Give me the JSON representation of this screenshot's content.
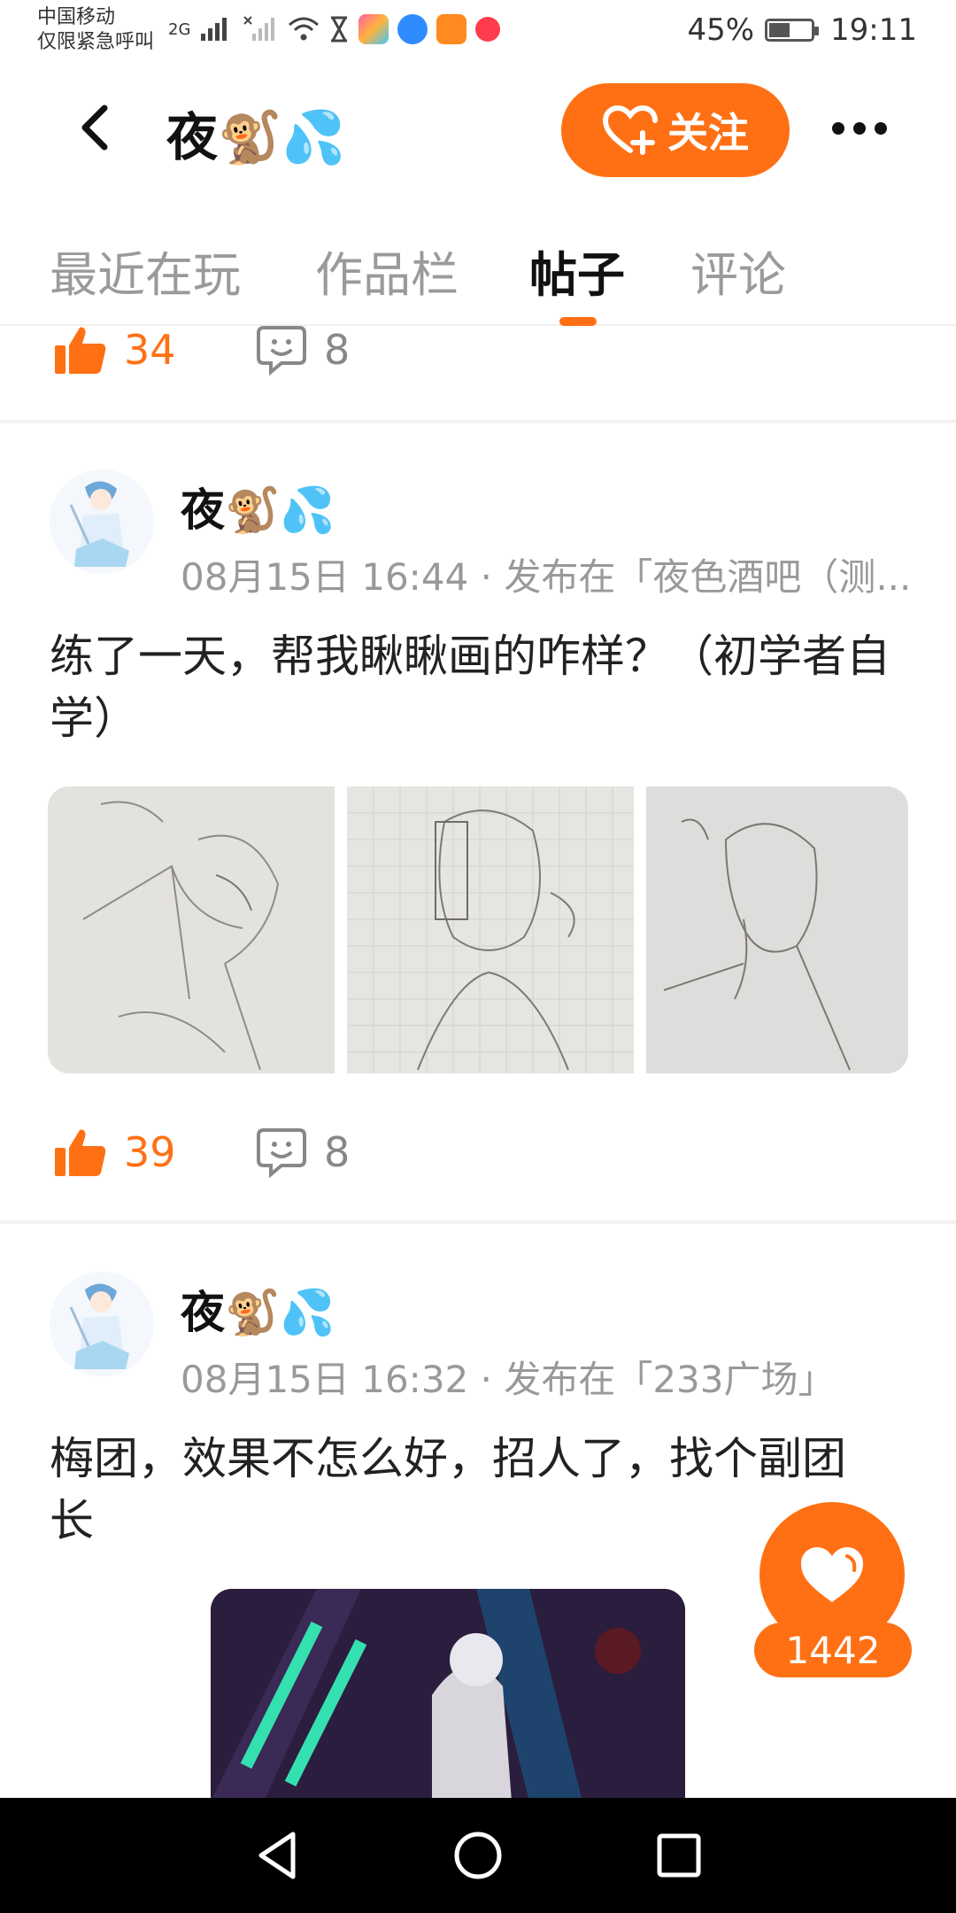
{
  "status_bar": {
    "carrier_line1": "中国移动",
    "carrier_line2": "仅限紧急呼叫",
    "network": "2G",
    "battery": "45%",
    "time": "19:11"
  },
  "header": {
    "title": "夜🐒💦",
    "follow_label": "关注"
  },
  "tabs": [
    {
      "label": "最近在玩"
    },
    {
      "label": "作品栏"
    },
    {
      "label": "帖子"
    },
    {
      "label": "评论"
    }
  ],
  "top_stats": {
    "likes": "34",
    "comments": "8"
  },
  "posts": [
    {
      "author": "夜🐒💦",
      "meta": "08月15日 16:44 · 发布在「夜色酒吧（测...",
      "text": "练了一天，帮我瞅瞅画的咋样？（初学者自学）",
      "likes": "39",
      "comments": "8"
    },
    {
      "author": "夜🐒💦",
      "meta": "08月15日 16:32 · 发布在「233广场」",
      "text": "梅团，效果不怎么好，招人了，找个副团　长"
    }
  ],
  "floating_like": {
    "count": "1442"
  },
  "colors": {
    "accent": "#ff7014"
  }
}
